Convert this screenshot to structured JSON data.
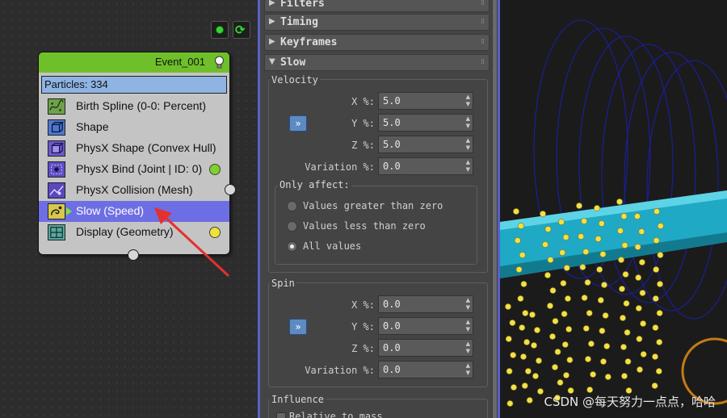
{
  "graph": {
    "event_title": "Event_001",
    "particles_text": "Particles: 334",
    "operators": [
      {
        "label": "Birth Spline (0-0: Percent)",
        "icon": "birth-spline-icon"
      },
      {
        "label": "Shape",
        "icon": "shape-cube-icon"
      },
      {
        "label": "PhysX Shape (Convex Hull)",
        "icon": "physx-shape-icon"
      },
      {
        "label": "PhysX Bind (Joint | ID: 0)",
        "icon": "physx-bind-icon"
      },
      {
        "label": "PhysX Collision (Mesh)",
        "icon": "physx-collision-icon"
      },
      {
        "label": "Slow (Speed)",
        "icon": "slow-speed-icon"
      },
      {
        "label": "Display (Geometry)",
        "icon": "display-geometry-icon"
      }
    ],
    "selected_operator": "Slow (Speed)"
  },
  "panel": {
    "rollouts": [
      "Filters",
      "Timing",
      "Keyframes",
      "Slow"
    ],
    "velocity": {
      "title": "Velocity",
      "x_label": "X %:",
      "x_value": "5.0",
      "y_label": "Y %:",
      "y_value": "5.0",
      "z_label": "Z %:",
      "z_value": "5.0",
      "var_label": "Variation %:",
      "var_value": "0.0",
      "link_button": "»"
    },
    "only_affect": {
      "title": "Only affect:",
      "options": [
        "Values greater than zero",
        "Values less than zero",
        "All values"
      ],
      "selected": "All values"
    },
    "spin": {
      "title": "Spin",
      "x_label": "X %:",
      "x_value": "0.0",
      "y_label": "Y %:",
      "y_value": "0.0",
      "z_label": "Z %:",
      "z_value": "0.0",
      "var_label": "Variation %:",
      "var_value": "0.0",
      "link_button": "»"
    },
    "influence": {
      "title": "Influence",
      "relative_label": "Relative to mass"
    }
  },
  "viewport": {
    "watermark": "CSDN @每天努力一点点，哈哈"
  },
  "colors": {
    "event_header": "#6fbf2a",
    "selected_row": "#6e6ee4",
    "pipe": "#1fa9c4",
    "particles": "#f2e04a",
    "helix": "#1a1fa0"
  }
}
